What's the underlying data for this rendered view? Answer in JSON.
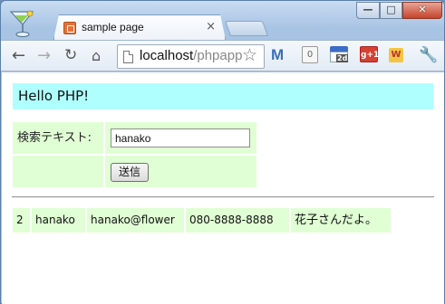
{
  "browser": {
    "tab_title": "sample page",
    "tab_close": "×",
    "url_host": "localhost",
    "url_path": "/phpapp",
    "extensions": {
      "count_badge": "0",
      "calendar_day": "2d",
      "gplus": "g+1",
      "w": "W"
    }
  },
  "page": {
    "heading": "Hello PHP!",
    "form": {
      "search_label": "検索テキスト:",
      "search_value": "hanako",
      "submit_label": "送信"
    },
    "results": [
      {
        "id": "2",
        "name": "hanako",
        "email": "hanako@flower",
        "tel": "080-8888-8888",
        "memo": "花子さんだよ。"
      }
    ]
  }
}
